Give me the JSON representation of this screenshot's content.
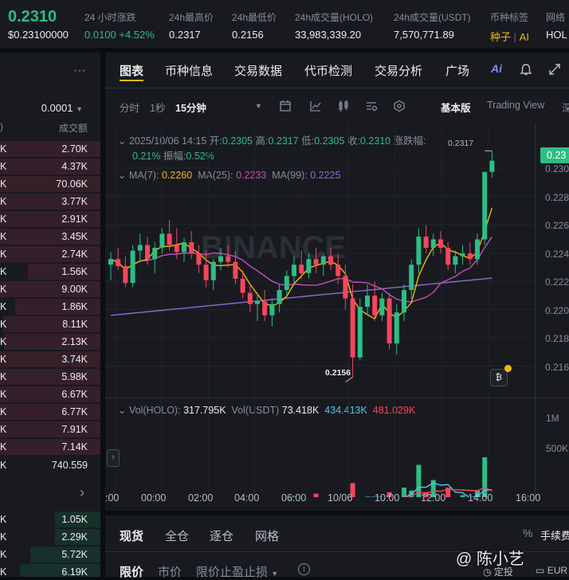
{
  "header": {
    "last_price": "0.2310",
    "last_price_usd": "$0.23100000",
    "stats": [
      {
        "label": "24 小时涨跌",
        "value": "0.0100 +4.52%"
      },
      {
        "label": "24h最高价",
        "value": "0.2317"
      },
      {
        "label": "24h最低价",
        "value": "0.2156"
      },
      {
        "label": "24h成交量(HOLO)",
        "value": "33,983,339.20"
      },
      {
        "label": "24h成交量(USDT)",
        "value": "7,570,771.89"
      },
      {
        "label": "币种标签",
        "value_tag1": "种子",
        "value_tag2": "AI"
      },
      {
        "label": "网络",
        "value": "HOL"
      }
    ]
  },
  "orderbook": {
    "more_label": "···",
    "precision": "0.0001",
    "col_left": ")",
    "col_right": "成交额",
    "asks": [
      {
        "k": "K",
        "v": "2.70K",
        "depth": 1.0
      },
      {
        "k": "K",
        "v": "4.37K",
        "depth": 1.0
      },
      {
        "k": "K",
        "v": "70.06K",
        "depth": 1.0
      },
      {
        "k": "K",
        "v": "3.77K",
        "depth": 1.0
      },
      {
        "k": "K",
        "v": "2.91K",
        "depth": 1.0
      },
      {
        "k": "K",
        "v": "3.45K",
        "depth": 1.0
      },
      {
        "k": "K",
        "v": "2.74K",
        "depth": 1.0
      },
      {
        "k": "K",
        "v": "1.56K",
        "depth": 0.72
      },
      {
        "k": "K",
        "v": "9.00K",
        "depth": 1.0
      },
      {
        "k": "K",
        "v": "1.86K",
        "depth": 0.85
      },
      {
        "k": "K",
        "v": "8.11K",
        "depth": 0.97
      },
      {
        "k": "K",
        "v": "2.13K",
        "depth": 0.96
      },
      {
        "k": "K",
        "v": "3.74K",
        "depth": 1.0
      },
      {
        "k": "K",
        "v": "5.98K",
        "depth": 1.0
      },
      {
        "k": "K",
        "v": "6.67K",
        "depth": 1.0
      },
      {
        "k": "K",
        "v": "6.77K",
        "depth": 1.0
      },
      {
        "k": "K",
        "v": "7.91K",
        "depth": 1.0
      },
      {
        "k": "K",
        "v": "7.14K",
        "depth": 1.0
      }
    ],
    "mid": {
      "k": "K",
      "v": "740.559"
    },
    "mid_arrow": "›",
    "bids": [
      {
        "k": "K",
        "v": "1.05K",
        "depth": 0.45
      },
      {
        "k": "K",
        "v": "2.29K",
        "depth": 0.45
      },
      {
        "k": "K",
        "v": "5.72K",
        "depth": 0.7
      },
      {
        "k": "K",
        "v": "6.19K",
        "depth": 0.8
      }
    ]
  },
  "chart_panel": {
    "tabs": [
      "图表",
      "币种信息",
      "交易数据",
      "代币检测",
      "交易分析",
      "广场"
    ],
    "active_tab": "图表",
    "toolbar": {
      "time_label": "分时",
      "sec_label": "1秒",
      "interval_label": "15分钟",
      "basic_label": "基本版",
      "tv_label": "Trading View",
      "depth_label": "深"
    },
    "ohlc": {
      "datetime": "2025/10/06 14:15",
      "open_label": "开:",
      "open": "0.2305",
      "high_label": "高:",
      "high": "0.2317",
      "low_label": "低:",
      "low": "0.2305",
      "close_label": "收:",
      "close": "0.2310",
      "chg_label": "涨跌幅:",
      "chg": "0.21%",
      "amp_label": "振幅:",
      "amp": "0.52%"
    },
    "ma": {
      "ma7_label": "MA(7):",
      "ma7": "0.2260",
      "ma25_label": "MA(25):",
      "ma25": "0.2233",
      "ma99_label": "MA(99):",
      "ma99": "0.2225"
    },
    "vol": {
      "vol_holo_label": "Vol(HOLO):",
      "vol_holo": "317.795K",
      "vol_usdt_label": "Vol(USDT)",
      "vol_usdt": "73.418K",
      "ma1": "434.413K",
      "ma2": "481.029K"
    },
    "watermark": "BINANCE",
    "high_mark": "0.2317",
    "low_mark": "0.2156",
    "price_tag": "0.23",
    "y_ticks": [
      "0.230",
      "0.228",
      "0.226",
      "0.224",
      "0.222",
      "0.220",
      "0.218",
      "0.216"
    ],
    "vol_ticks": [
      "1M",
      "500K"
    ],
    "x_ticks": [
      ":00",
      "00:00",
      "02:00",
      "04:00",
      "06:00",
      "10/06",
      "10:00",
      "12:00",
      "14:00",
      "16:00"
    ],
    "colors": {
      "up": "#2ebd85",
      "down": "#f6465d",
      "ma7": "#f0b90b",
      "ma25": "#c74db8",
      "ma99": "#8f6bd1"
    }
  },
  "bottom_panel": {
    "tabs": [
      "现货",
      "全仓",
      "逐仓",
      "网格"
    ],
    "fee_label": "手续费",
    "order_types": [
      "限价",
      "市价",
      "限价止盈止损"
    ],
    "right_items": [
      "定投",
      "EUR"
    ],
    "watermark_text": "@ 陈小艺"
  },
  "chart_data": {
    "type": "candlestick",
    "x_label_ticks": [
      ":00",
      "00:00",
      "02:00",
      "04:00",
      "06:00",
      "10/06",
      "10:00",
      "12:00",
      "14:00",
      "16:00"
    ],
    "ylim": [
      0.215,
      0.232
    ],
    "candles": [
      [
        0.2236,
        0.2245,
        0.2225,
        0.224
      ],
      [
        0.224,
        0.2248,
        0.2232,
        0.2235
      ],
      [
        0.2235,
        0.2242,
        0.222,
        0.2223
      ],
      [
        0.2223,
        0.225,
        0.222,
        0.2246
      ],
      [
        0.2246,
        0.2258,
        0.2238,
        0.225
      ],
      [
        0.225,
        0.2256,
        0.2236,
        0.224
      ],
      [
        0.224,
        0.2252,
        0.223,
        0.2248
      ],
      [
        0.2248,
        0.2262,
        0.2244,
        0.2258
      ],
      [
        0.2258,
        0.2268,
        0.2246,
        0.225
      ],
      [
        0.225,
        0.2262,
        0.224,
        0.2245
      ],
      [
        0.2245,
        0.2255,
        0.2238,
        0.2252
      ],
      [
        0.2252,
        0.226,
        0.224,
        0.2244
      ],
      [
        0.2244,
        0.225,
        0.223,
        0.2236
      ],
      [
        0.2236,
        0.2246,
        0.222,
        0.2225
      ],
      [
        0.2225,
        0.224,
        0.2218,
        0.2238
      ],
      [
        0.2238,
        0.2248,
        0.2232,
        0.2242
      ],
      [
        0.2242,
        0.225,
        0.2234,
        0.2238
      ],
      [
        0.2238,
        0.2246,
        0.2222,
        0.2226
      ],
      [
        0.2226,
        0.2232,
        0.2212,
        0.2216
      ],
      [
        0.2216,
        0.2222,
        0.2202,
        0.2208
      ],
      [
        0.2208,
        0.2216,
        0.2196,
        0.221
      ],
      [
        0.221,
        0.2218,
        0.2196,
        0.22
      ],
      [
        0.22,
        0.2212,
        0.2192,
        0.2208
      ],
      [
        0.2208,
        0.2222,
        0.2202,
        0.2218
      ],
      [
        0.2218,
        0.2232,
        0.2214,
        0.2228
      ],
      [
        0.2228,
        0.2242,
        0.2222,
        0.2236
      ],
      [
        0.2236,
        0.2246,
        0.2226,
        0.223
      ],
      [
        0.223,
        0.2244,
        0.2226,
        0.224
      ],
      [
        0.224,
        0.2248,
        0.223,
        0.2236
      ],
      [
        0.2236,
        0.2244,
        0.2228,
        0.2242
      ],
      [
        0.2242,
        0.2248,
        0.2232,
        0.2236
      ],
      [
        0.2236,
        0.2244,
        0.2222,
        0.2228
      ],
      [
        0.2228,
        0.2236,
        0.2204,
        0.2212
      ],
      [
        0.2212,
        0.2222,
        0.2156,
        0.217
      ],
      [
        0.217,
        0.2212,
        0.2168,
        0.2206
      ],
      [
        0.2206,
        0.2222,
        0.22,
        0.2214
      ],
      [
        0.2214,
        0.2224,
        0.2196,
        0.22
      ],
      [
        0.22,
        0.2216,
        0.2196,
        0.2212
      ],
      [
        0.2212,
        0.2216,
        0.2176,
        0.218
      ],
      [
        0.218,
        0.2208,
        0.2172,
        0.2202
      ],
      [
        0.2202,
        0.2222,
        0.2196,
        0.2218
      ],
      [
        0.2218,
        0.224,
        0.2212,
        0.2236
      ],
      [
        0.2236,
        0.2262,
        0.223,
        0.2256
      ],
      [
        0.2256,
        0.2264,
        0.2244,
        0.2248
      ],
      [
        0.2248,
        0.2258,
        0.2242,
        0.2254
      ],
      [
        0.2254,
        0.226,
        0.2244,
        0.2248
      ],
      [
        0.2248,
        0.2252,
        0.2232,
        0.2236
      ],
      [
        0.2236,
        0.2246,
        0.223,
        0.2242
      ],
      [
        0.2242,
        0.225,
        0.2236,
        0.2244
      ],
      [
        0.2244,
        0.2252,
        0.2236,
        0.224
      ],
      [
        0.224,
        0.2258,
        0.2236,
        0.2254
      ],
      [
        0.2254,
        0.23,
        0.225,
        0.2302
      ],
      [
        0.2302,
        0.2317,
        0.2298,
        0.231
      ]
    ],
    "volumes": [
      0.18,
      0.22,
      0.3,
      0.28,
      0.2,
      0.32,
      0.24,
      0.3,
      0.36,
      0.26,
      0.42,
      0.2,
      0.28,
      0.34,
      0.3,
      0.22,
      0.26,
      0.4,
      0.34,
      0.46,
      0.3,
      0.38,
      0.26,
      0.42,
      0.34,
      0.48,
      0.3,
      0.36,
      0.52,
      0.3,
      0.38,
      0.34,
      0.46,
      0.66,
      0.4,
      0.48,
      0.36,
      0.44,
      0.54,
      0.42,
      0.6,
      0.56,
      0.9,
      0.54,
      0.7,
      0.46,
      0.6,
      0.4,
      0.5,
      0.36,
      0.56,
      1.0,
      0.44
    ]
  }
}
